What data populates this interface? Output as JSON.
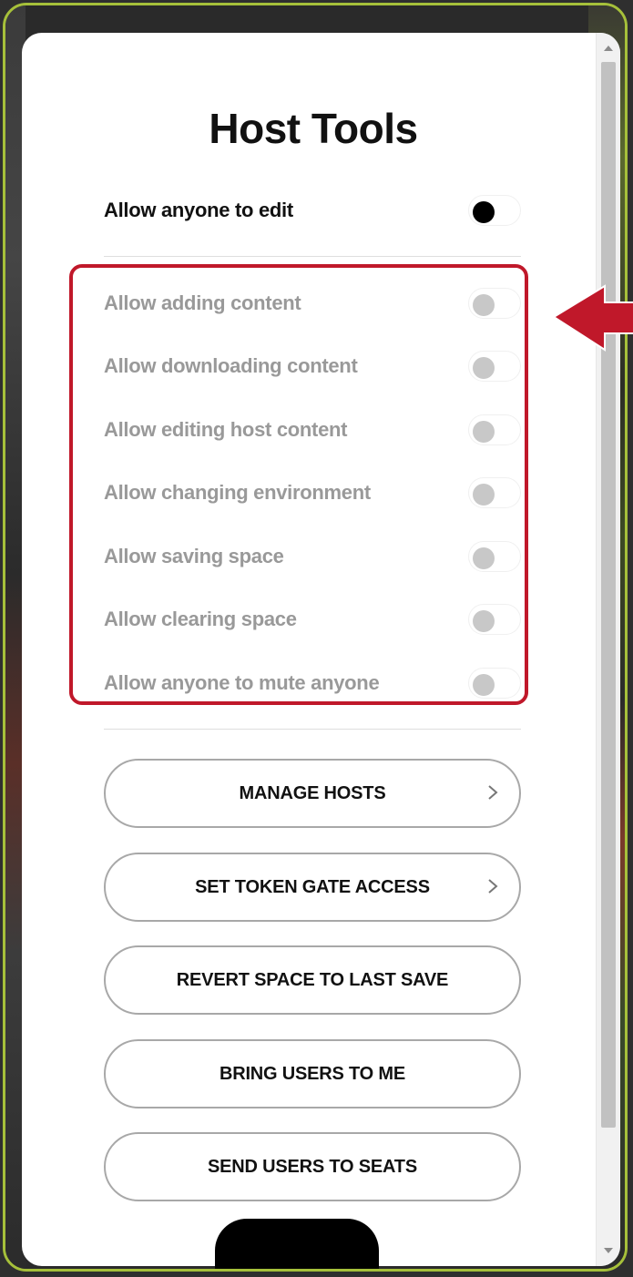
{
  "panel": {
    "title": "Host Tools"
  },
  "master_toggle": {
    "label": "Allow anyone to edit",
    "state": "on"
  },
  "permissions": [
    {
      "label": "Allow adding content",
      "state": "off"
    },
    {
      "label": "Allow downloading content",
      "state": "off"
    },
    {
      "label": "Allow editing host content",
      "state": "off"
    },
    {
      "label": "Allow changing environment",
      "state": "off"
    },
    {
      "label": "Allow saving space",
      "state": "off"
    },
    {
      "label": "Allow clearing space",
      "state": "off"
    },
    {
      "label": "Allow anyone to mute anyone",
      "state": "off"
    }
  ],
  "actions": [
    {
      "label": "MANAGE HOSTS",
      "icon": "chevron-right-icon"
    },
    {
      "label": "SET TOKEN GATE ACCESS",
      "icon": "chevron-right-icon"
    },
    {
      "label": "REVERT SPACE TO LAST SAVE"
    },
    {
      "label": "BRING USERS TO ME"
    },
    {
      "label": "SEND USERS TO SEATS"
    }
  ],
  "colors": {
    "frame_border": "#a6c03a",
    "highlight": "#c0182a",
    "toggle_on_knob": "#000000",
    "toggle_off_knob": "#c8c8c8"
  }
}
